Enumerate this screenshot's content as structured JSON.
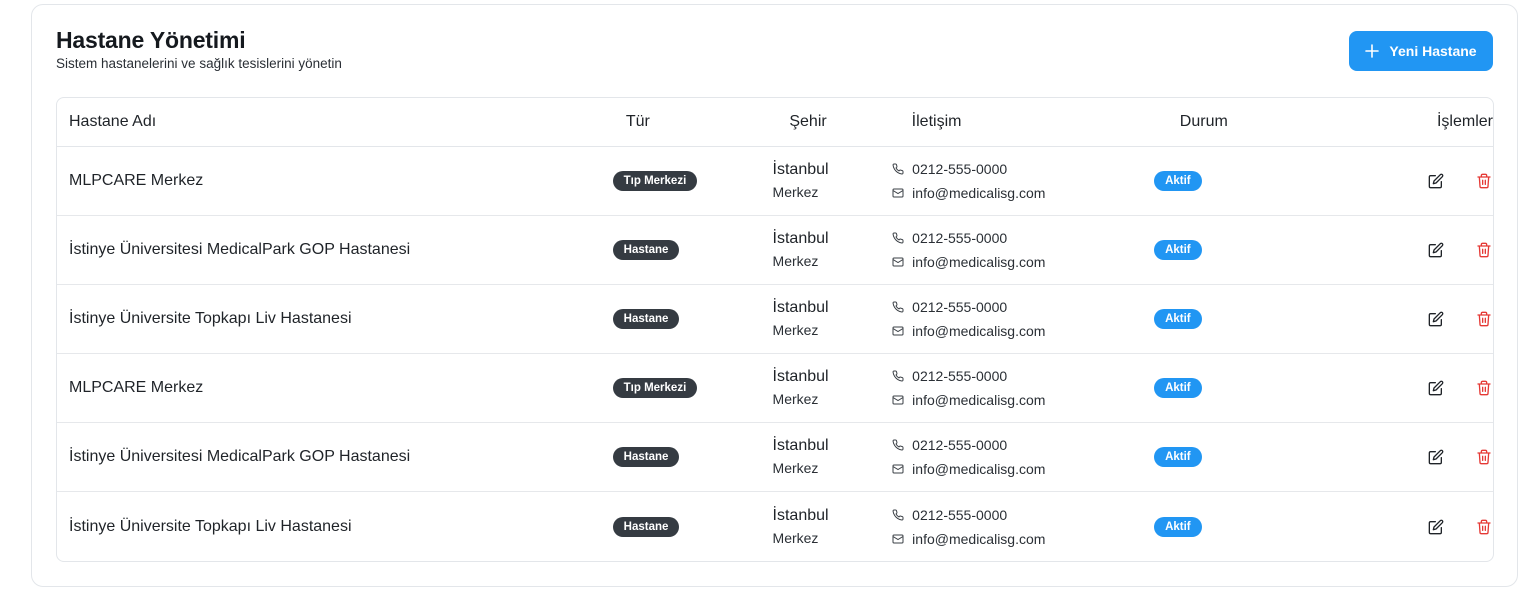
{
  "header": {
    "title": "Hastane Yönetimi",
    "subtitle": "Sistem hastanelerini ve sağlık tesislerini yönetin",
    "new_button_label": "Yeni Hastane"
  },
  "table": {
    "columns": [
      "Hastane Adı",
      "Tür",
      "Şehir",
      "İletişim",
      "Durum",
      "İşlemler"
    ],
    "rows": [
      {
        "name": "MLPCARE Merkez",
        "type": "Tıp Merkezi",
        "city": "İstanbul",
        "district": "Merkez",
        "phone": "0212-555-0000",
        "email": "info@medicalisg.com",
        "status": "Aktif"
      },
      {
        "name": "İstinye Üniversitesi MedicalPark GOP Hastanesi",
        "type": "Hastane",
        "city": "İstanbul",
        "district": "Merkez",
        "phone": "0212-555-0000",
        "email": "info@medicalisg.com",
        "status": "Aktif"
      },
      {
        "name": "İstinye Üniversite Topkapı Liv Hastanesi",
        "type": "Hastane",
        "city": "İstanbul",
        "district": "Merkez",
        "phone": "0212-555-0000",
        "email": "info@medicalisg.com",
        "status": "Aktif"
      },
      {
        "name": "MLPCARE Merkez",
        "type": "Tıp Merkezi",
        "city": "İstanbul",
        "district": "Merkez",
        "phone": "0212-555-0000",
        "email": "info@medicalisg.com",
        "status": "Aktif"
      },
      {
        "name": "İstinye Üniversitesi MedicalPark GOP Hastanesi",
        "type": "Hastane",
        "city": "İstanbul",
        "district": "Merkez",
        "phone": "0212-555-0000",
        "email": "info@medicalisg.com",
        "status": "Aktif"
      },
      {
        "name": "İstinye Üniversite Topkapı Liv Hastanesi",
        "type": "Hastane",
        "city": "İstanbul",
        "district": "Merkez",
        "phone": "0212-555-0000",
        "email": "info@medicalisg.com",
        "status": "Aktif"
      }
    ]
  },
  "icons": {
    "new": "plus-icon",
    "phone": "phone-icon",
    "email": "mail-icon",
    "edit": "edit-icon",
    "delete": "trash-icon"
  },
  "colors": {
    "accent": "#2196f3",
    "type_badge": "#353b42",
    "delete": "#e53935"
  }
}
